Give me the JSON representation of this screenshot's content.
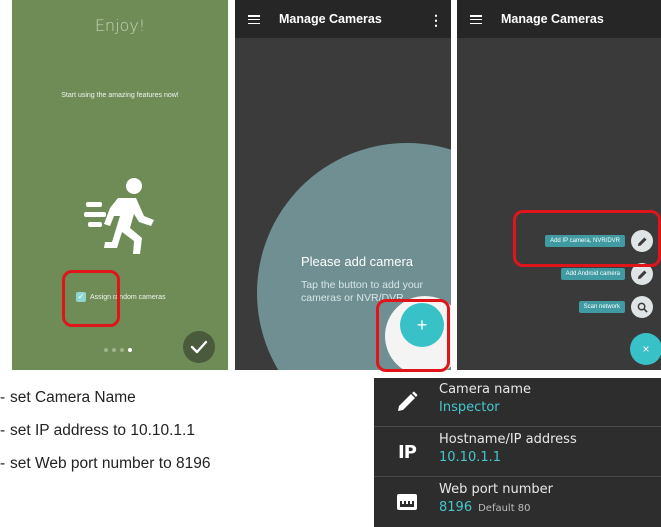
{
  "colors": {
    "onboard_bg": "#6f8c57",
    "appbar": "#262626",
    "accent": "#39c1c8",
    "highlight": "#e0141b"
  },
  "onboarding": {
    "title": "Enjoy!",
    "subtitle": "Start using the amazing features now!",
    "checkbox_label": "Assign random cameras",
    "checkbox_checked": true,
    "page_count": 4,
    "active_page": 4,
    "icons": {
      "hero": "running-person-icon",
      "done": "check-icon"
    }
  },
  "manage_empty": {
    "app_title": "Manage Cameras",
    "empty_title": "Please add camera",
    "empty_desc": "Tap the button to add your cameras or NVR/DVR",
    "fab_label": "+"
  },
  "manage_options": {
    "app_title": "Manage Cameras",
    "options": [
      {
        "label": "Add IP camera, NVR/DVR",
        "icon": "pencil-icon"
      },
      {
        "label": "Add Android camera",
        "icon": "pencil-icon"
      },
      {
        "label": "Scan network",
        "icon": "search-icon"
      }
    ],
    "fab_label": "×"
  },
  "steps": [
    {
      "dash": "-",
      "text": "set Camera Name"
    },
    {
      "dash": "-",
      "text": "set IP address to 10.10.1.1"
    },
    {
      "dash": "-",
      "text": "set Web port number to 8196"
    }
  ],
  "settings": [
    {
      "label": "Camera name",
      "value": "Inspector",
      "hint": "",
      "icon": "pencil-icon"
    },
    {
      "label": "Hostname/IP address",
      "value": "10.10.1.1",
      "hint": "",
      "icon": "ip-icon",
      "icon_text": "IP"
    },
    {
      "label": "Web port number",
      "value": "8196",
      "hint": "Default 80",
      "icon": "ethernet-port-icon"
    }
  ]
}
